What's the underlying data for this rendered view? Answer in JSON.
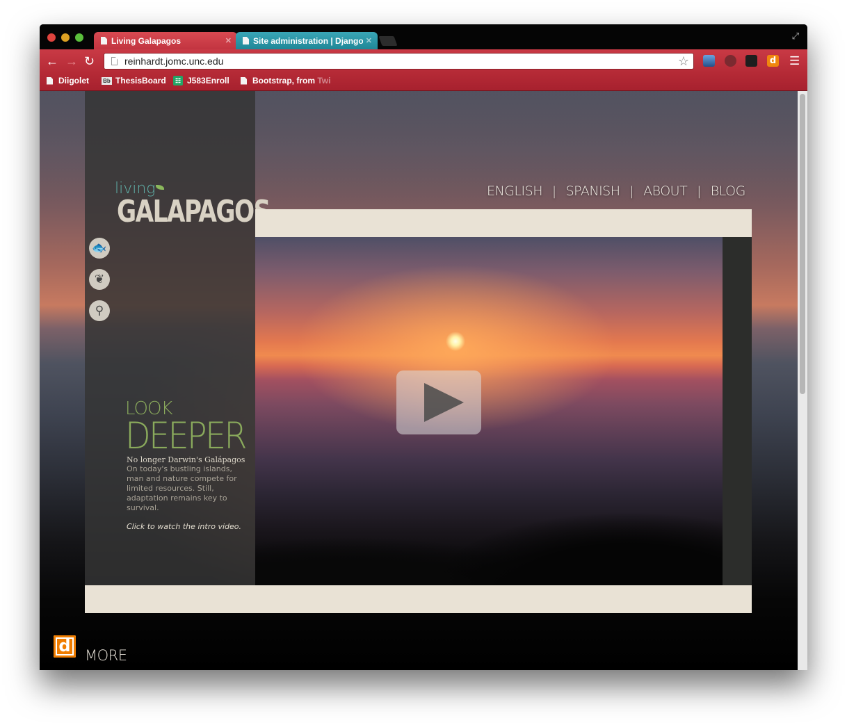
{
  "browser": {
    "tabs": [
      {
        "title": "Living Galapagos",
        "close": "✕",
        "active": true
      },
      {
        "title": "Site administration | Django",
        "close": "✕",
        "active": false
      }
    ],
    "url": "reinhardt.jomc.unc.edu",
    "bookmarks": [
      {
        "label": "Diigolet"
      },
      {
        "label": "ThesisBoard",
        "badge": "Bb"
      },
      {
        "label": "J583Enroll"
      },
      {
        "label": "Bootstrap, from Twi",
        "visible_prefix": "Bootstrap, from ",
        "faded_suffix": "Twi"
      }
    ],
    "extension_badge": "d"
  },
  "site": {
    "logo": {
      "top": "living",
      "bottom": "GALAPAGOS"
    },
    "nav": [
      {
        "label": "ENGLISH"
      },
      {
        "label": "SPANISH"
      },
      {
        "label": "ABOUT"
      },
      {
        "label": "BLOG"
      }
    ],
    "nav_separator": "|",
    "side_icons": [
      "fish-icon",
      "leaf-icon",
      "search-icon"
    ],
    "intro": {
      "look": "LOOK",
      "deeper": "DEEPER",
      "tagline": "No longer Darwin's Galápagos",
      "body": "On today's bustling islands, man and nature compete for limited resources. Still, adaptation remains key to survival.",
      "cta": "Click to watch the intro video."
    },
    "more": {
      "badge": "d",
      "label": "MORE"
    }
  },
  "colors": {
    "browser_red": "#c93a45",
    "inactive_tab": "#2fa0b1",
    "beige_panel": "#e9e2d5",
    "accent_green": "#8aaa5c",
    "diigo_orange": "#f07d00"
  }
}
